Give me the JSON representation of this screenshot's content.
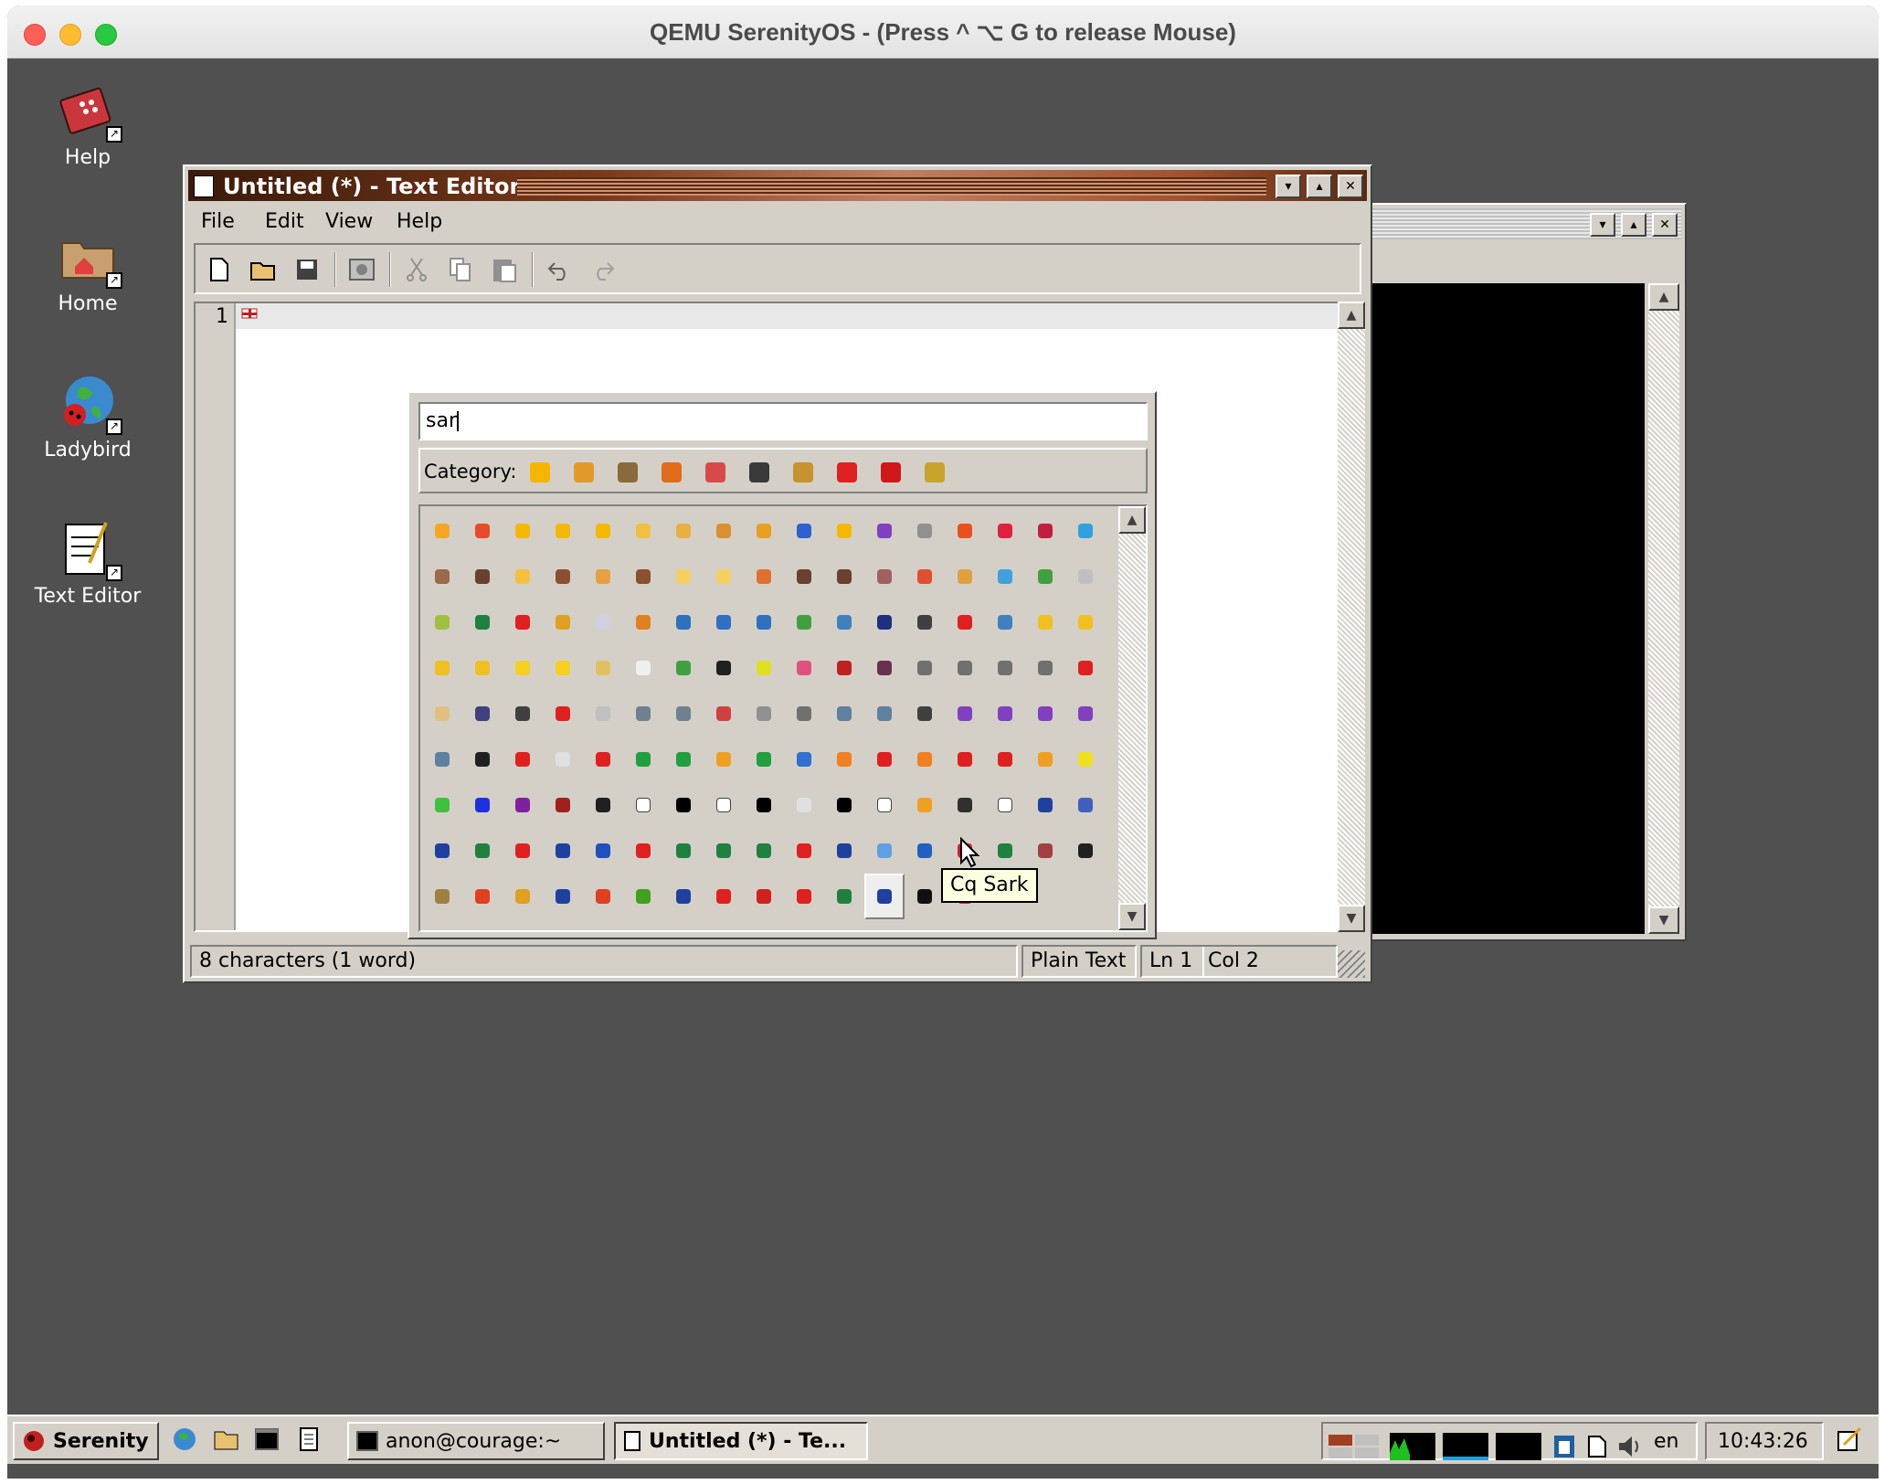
{
  "host_window": {
    "title": "QEMU SerenityOS - (Press ^ ⌥ G  to release Mouse)"
  },
  "desktop": {
    "icons": [
      {
        "label": "Help",
        "icon": "help-book-icon"
      },
      {
        "label": "Home",
        "icon": "home-folder-icon"
      },
      {
        "label": "Ladybird",
        "icon": "ladybird-globe-icon"
      },
      {
        "label": "Text Editor",
        "icon": "text-editor-icon"
      }
    ]
  },
  "text_editor": {
    "title": "Untitled (*) - Text Editor",
    "menu": [
      "File",
      "Edit",
      "View",
      "Help"
    ],
    "toolbar": [
      "new-file-icon",
      "open-folder-icon",
      "save-icon",
      "preview-icon",
      "cut-icon",
      "copy-icon",
      "paste-icon",
      "undo-icon",
      "redo-icon"
    ],
    "line_number": "1",
    "content_glyph": "🇬🇬",
    "status": {
      "stats": "8 characters (1 word)",
      "syntax": "Plain Text",
      "line": "Ln 1",
      "column": "Col 2"
    }
  },
  "emoji_picker": {
    "search_value": "sar",
    "category_label": "Category:",
    "category_colors": [
      "#f4b400",
      "#e39a2a",
      "#8a6a3a",
      "#e06b1a",
      "#d84a4a",
      "#3a3a3a",
      "#c8922e",
      "#e02020",
      "#d01818",
      "#c8a42a"
    ],
    "emoji_colors": [
      "#f5a623",
      "#e84a2b",
      "#f5b800",
      "#f5b800",
      "#f5b800",
      "#f0c040",
      "#e8b040",
      "#d89030",
      "#e8a020",
      "#3060d0",
      "#f5b800",
      "#8040c0",
      "#909090",
      "#e85020",
      "#e02040",
      "#c02040",
      "#30a0e0",
      "#9a6a4a",
      "#6a4030",
      "#f5c040",
      "#8a5030",
      "#e8a040",
      "#8a5030",
      "#f5d060",
      "#f5d060",
      "#e07030",
      "#6a4030",
      "#6a4030",
      "#a06060",
      "#e05030",
      "#e0a040",
      "#40a0e0",
      "#40a040",
      "#c0c0c0",
      "#a0c040",
      "#208040",
      "#e02020",
      "#e0a020",
      "#d0d0e0",
      "#e08020",
      "#3070c0",
      "#3070c0",
      "#3070c0",
      "#40a040",
      "#4080c0",
      "#203080",
      "#404040",
      "#e02020",
      "#4080c0",
      "#f0c020",
      "#f0c020",
      "#f0c020",
      "#f0c020",
      "#f5d020",
      "#f5d020",
      "#e0c060",
      "#f0f0f0",
      "#40a040",
      "#202020",
      "#e0e020",
      "#e05080",
      "#c02020",
      "#6a3050",
      "#707070",
      "#707070",
      "#707070",
      "#707070",
      "#e02020",
      "#e0c080",
      "#404080",
      "#404040",
      "#e02020",
      "#c0c0c0",
      "#708090",
      "#708090",
      "#d04040",
      "#909090",
      "#707070",
      "#6080a0",
      "#6080a0",
      "#404040",
      "#8040c0",
      "#8040c0",
      "#8040c0",
      "#8040c0",
      "#6080a0",
      "#202020",
      "#e02020",
      "#e0e0e0",
      "#e02020",
      "#20a040",
      "#20a040",
      "#f0a020",
      "#20a040",
      "#3070d0",
      "#f08020",
      "#e02020",
      "#f08020",
      "#e02020",
      "#e02020",
      "#f0a020",
      "#f0e020",
      "#40c040",
      "#2030e0",
      "#8020a0",
      "#a02020",
      "#202020",
      "#ffffff",
      "#000000",
      "#ffffff",
      "#000000",
      "#e0e0e0",
      "#000000",
      "#ffffff",
      "#f0a020",
      "#303030",
      "#ffffff",
      "#2040a0",
      "#4060c0",
      "#2040a0",
      "#208040",
      "#e02020",
      "#2040a0",
      "#2050c0",
      "#e02020",
      "#208040",
      "#208040",
      "#208040",
      "#e02020",
      "#2040a0",
      "#60a0e0",
      "#2060c0",
      "#d02020",
      "#208040",
      "#a04040",
      "#202020",
      "#a08040",
      "#e04020",
      "#e0a020",
      "#2040a0",
      "#e04020",
      "#40a020",
      "#2040a0",
      "#e02020",
      "#d02020",
      "#e02020",
      "#208040",
      "#2040a0",
      "#101010",
      "#e02020"
    ],
    "selected_index": 147,
    "tooltip": "Cq Sark"
  },
  "taskbar": {
    "start_label": "Serenity",
    "quick_launch": [
      "browser-icon",
      "file-manager-icon",
      "terminal-icon",
      "text-editor-icon"
    ],
    "tasks": [
      {
        "label": "anon@courage:~",
        "icon": "terminal-icon",
        "active": false
      },
      {
        "label": "Untitled (*) - Te...",
        "icon": "text-editor-icon",
        "active": true
      }
    ],
    "tray": [
      "workspaces-icon",
      "cpu-graph-icon",
      "network-graph-icon",
      "memory-graph-icon",
      "clipboard-icon",
      "file-icon",
      "volume-icon"
    ],
    "keymap": "en",
    "clock": "10:43:26"
  }
}
